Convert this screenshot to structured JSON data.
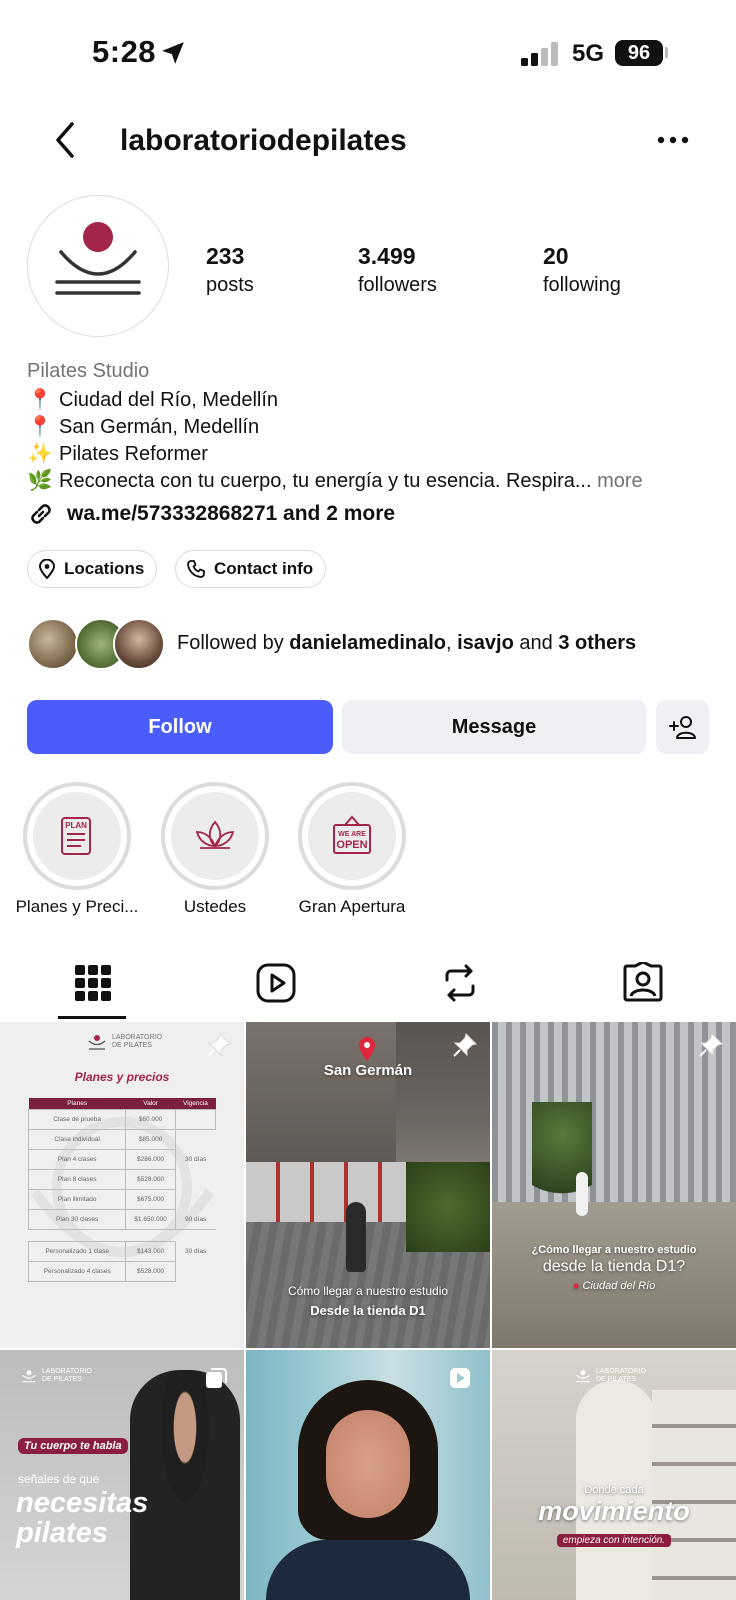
{
  "status_bar": {
    "time": "5:28",
    "network": "5G",
    "battery": "96"
  },
  "header": {
    "username": "laboratoriodepilates"
  },
  "stats": [
    {
      "value": "233",
      "label": "posts"
    },
    {
      "value": "3.499",
      "label": "followers"
    },
    {
      "value": "20",
      "label": "following"
    }
  ],
  "bio": {
    "category": "Pilates Studio",
    "lines": [
      {
        "emoji": "📍",
        "text": "Ciudad del Río, Medellín"
      },
      {
        "emoji": "📍",
        "text": "San Germán, Medellín"
      },
      {
        "emoji": "✨",
        "text": "Pilates Reformer"
      },
      {
        "emoji": "🌿",
        "text": "Reconecta con tu cuerpo, tu energía y tu esencia. Respira..."
      }
    ],
    "more_label": "more",
    "link": "wa.me/573332868271 and 2 more"
  },
  "chips": {
    "locations": "Locations",
    "contact": "Contact info"
  },
  "followed_by": {
    "prefix": "Followed by",
    "user1": "danielamedinalo",
    "sep": ",",
    "user2": "isavjo",
    "and": "and",
    "others": "3 others"
  },
  "actions": {
    "follow": "Follow",
    "message": "Message"
  },
  "highlights": [
    {
      "label": "Planes y Preci...",
      "icon": "plan-scroll-icon"
    },
    {
      "label": "Ustedes",
      "icon": "lotus-icon"
    },
    {
      "label": "Gran Apertura",
      "icon": "open-sign-icon"
    }
  ],
  "grid": {
    "post1": {
      "brand": "LABORATORIO DE PILATES",
      "title": "Planes y precios",
      "headers": [
        "Planes",
        "Valor",
        "Vigencia"
      ],
      "rows": [
        [
          "Clase de prueba",
          "$60.000",
          ""
        ],
        [
          "Clase individual",
          "$85.000",
          ""
        ],
        [
          "Plan 4 clases",
          "$286.000",
          "30 días"
        ],
        [
          "Plan 8 clases",
          "$528.000",
          ""
        ],
        [
          "Plan ilimitado",
          "$675.000",
          ""
        ],
        [
          "Plan 30 clases",
          "$1.650.000",
          "90 días"
        ],
        [
          "Personalizado 1 clase",
          "$143.000",
          "30 días"
        ],
        [
          "Personalizado 4 clases",
          "$528.000",
          ""
        ]
      ]
    },
    "post2": {
      "place": "San Germán",
      "line1": "Cómo llegar a nuestro estudio",
      "line2": "Desde la tienda D1"
    },
    "post3": {
      "line1": "¿Cómo llegar a nuestro estudio",
      "line2": "desde la tienda D1?",
      "place": "Ciudad del Río"
    },
    "post4": {
      "brand": "LABORATORIO DE PILATES",
      "tag": "Tu cuerpo te habla",
      "small": "señales de que",
      "big1": "necesitas",
      "big2": "pilates"
    },
    "post6": {
      "brand": "LABORATORIO DE PILATES",
      "small": "Donde cada",
      "big": "movimiento",
      "tag": "empieza con intención."
    }
  },
  "colors": {
    "follow": "#4a5dfa",
    "brand": "#a3254a"
  }
}
